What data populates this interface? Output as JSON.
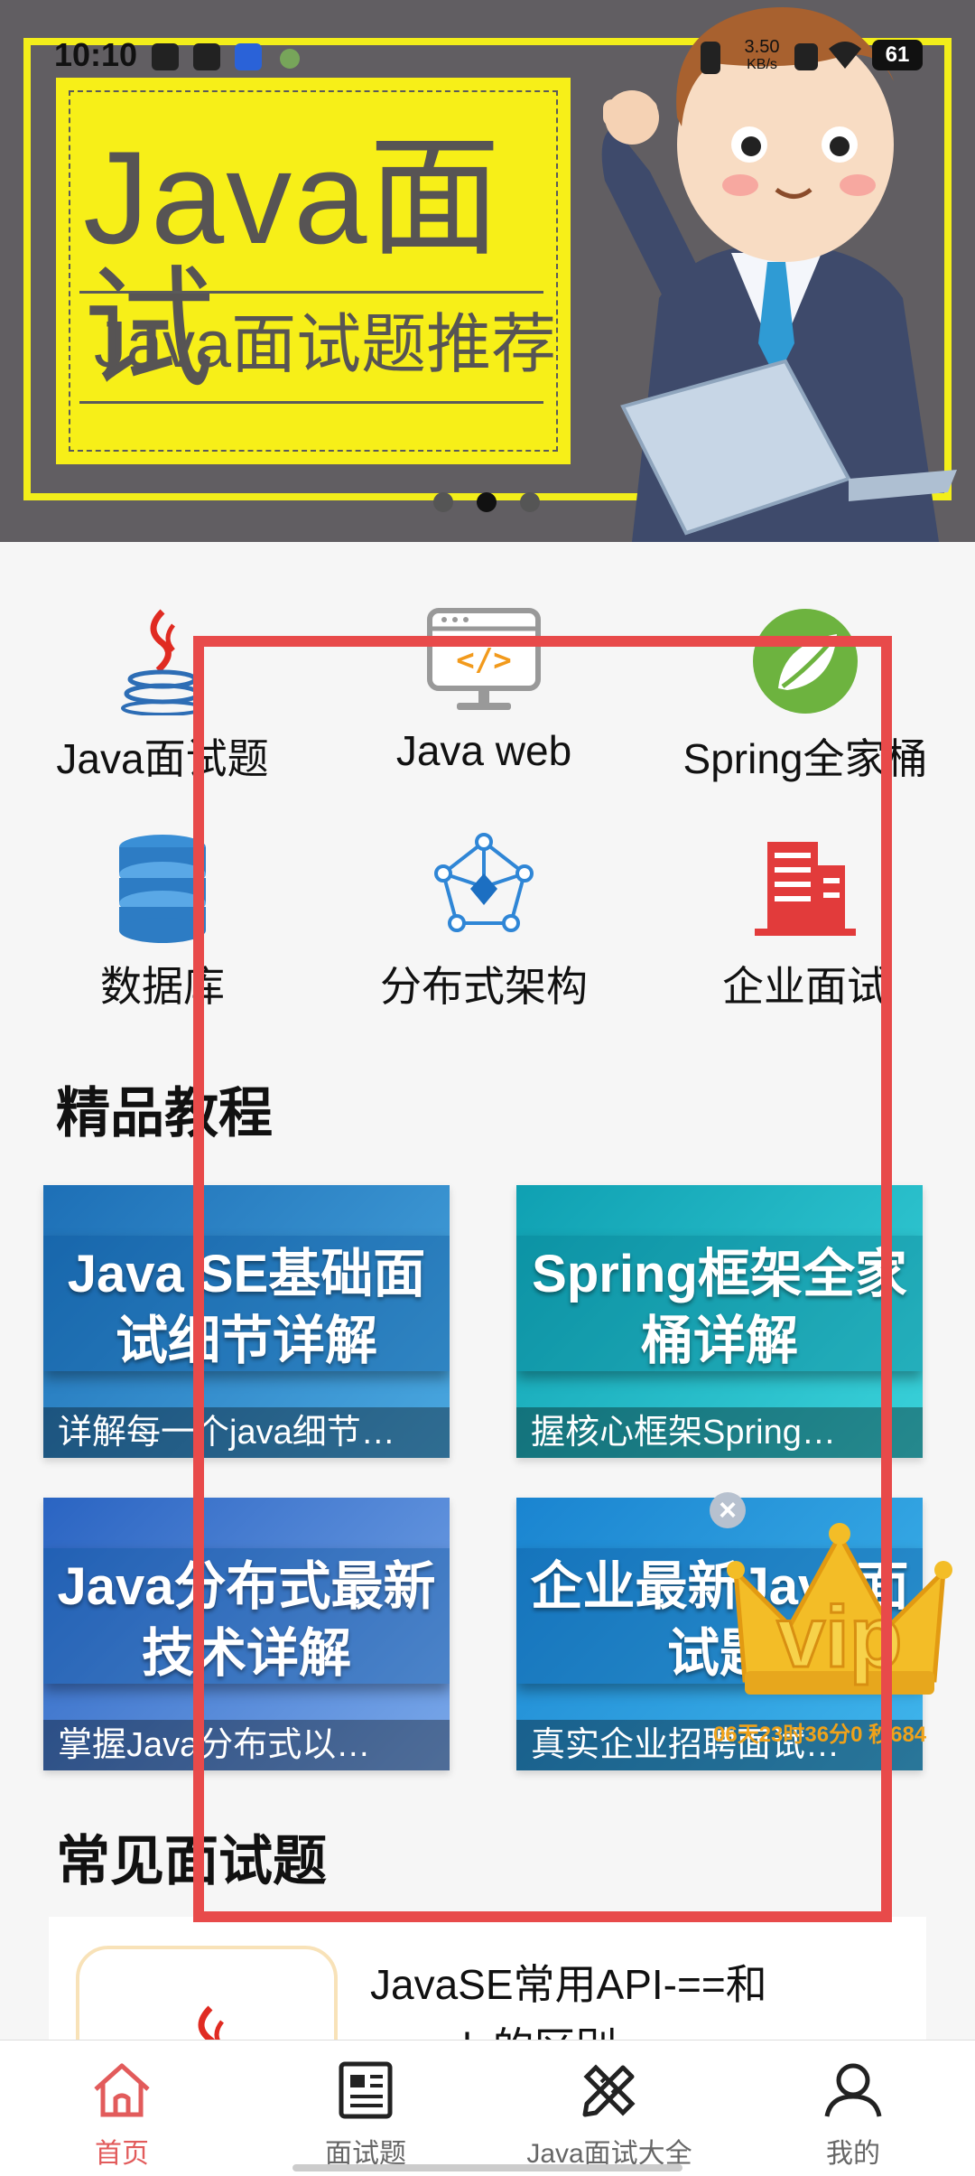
{
  "status_bar": {
    "time": "10:10",
    "net_speed": "3.50\nKB/s",
    "net_speed_value": "3.50",
    "net_speed_unit": "KB/s",
    "battery": "61"
  },
  "banner": {
    "title": "Java面试",
    "subtitle": "Java面试题推荐",
    "page_count": 3,
    "active_index": 1
  },
  "categories": [
    {
      "label": "Java面试题",
      "icon": "java-cup-icon"
    },
    {
      "label": "Java web",
      "icon": "web-code-icon"
    },
    {
      "label": "Spring全家桶",
      "icon": "spring-leaf-icon"
    },
    {
      "label": "数据库",
      "icon": "database-icon"
    },
    {
      "label": "分布式架构",
      "icon": "distributed-network-icon"
    },
    {
      "label": "企业面试",
      "icon": "building-icon"
    }
  ],
  "tutorials_section": {
    "title": "精品教程",
    "items": [
      {
        "title": "Java SE基础面试细节详解",
        "subtitle": "详解每一个java细节…",
        "color_top": "#1f7fc7",
        "color_bottom": "#4aa8e0"
      },
      {
        "title": "Spring框架全家桶详解",
        "subtitle": "握核心框架Spring…",
        "color_top": "#12a9b9",
        "color_bottom": "#37cfd8"
      },
      {
        "title": "Java分布式最新技术详解",
        "subtitle": "掌握Java分布式以…",
        "color_top": "#2f6fc9",
        "color_bottom": "#6b9de6"
      },
      {
        "title": "企业最新Java面试题",
        "subtitle": "真实企业招聘面试…",
        "color_top": "#1f8ed8",
        "color_bottom": "#3ab2ea"
      }
    ]
  },
  "vip": {
    "label": "vip",
    "timer": "06天23时36分0 秒684"
  },
  "questions_section": {
    "title": "常见面试题",
    "items": [
      {
        "text": "JavaSE常用API-==和equals的区别"
      }
    ]
  },
  "bottom_nav": [
    {
      "label": "首页",
      "icon": "home-icon",
      "active": true
    },
    {
      "label": "面试题",
      "icon": "newspaper-icon",
      "active": false
    },
    {
      "label": "Java面试大全",
      "icon": "pencil-ruler-icon",
      "active": false
    },
    {
      "label": "我的",
      "icon": "user-icon",
      "active": false
    }
  ],
  "colors": {
    "accent": "#e84a4a",
    "nav_active": "#e25b5b",
    "banner_yellow": "#f7ef18"
  }
}
